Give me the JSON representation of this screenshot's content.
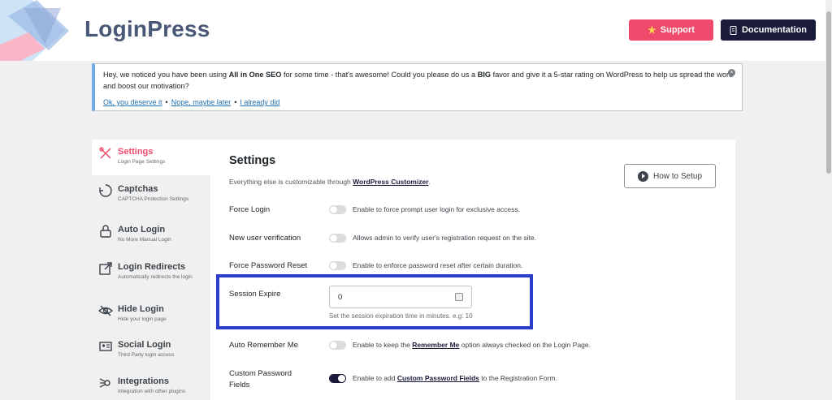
{
  "header": {
    "logo_text": "LoginPress",
    "support_label": "Support",
    "docs_label": "Documentation"
  },
  "notice": {
    "text_before": "Hey, we noticed you have been using ",
    "product": "All in One SEO",
    "text_mid": " for some time - that's awesome! Could you please do us a ",
    "emphasis": "BIG",
    "text_after": " favor and give it a 5-star rating on WordPress to help us spread the word and boost our motivation?",
    "links": [
      "Ok, you deserve it",
      "Nope, maybe later",
      "I already did"
    ],
    "dot": "•",
    "close_glyph": "×"
  },
  "sidebar": {
    "items": [
      {
        "title": "Settings",
        "sub": "Login Page Settings"
      },
      {
        "title": "Captchas",
        "sub": "CAPTCHA Protection Settings"
      },
      {
        "title": "Auto Login",
        "sub": "No More Manual Login"
      },
      {
        "title": "Login Redirects",
        "sub": "Automatically redirects the login"
      },
      {
        "title": "Hide Login",
        "sub": "Hide your login page"
      },
      {
        "title": "Social Login",
        "sub": "Third Party login access"
      },
      {
        "title": "Integrations",
        "sub": "Integration with other plugins"
      }
    ]
  },
  "main": {
    "title": "Settings",
    "desc_before": "Everything else is customizable through ",
    "desc_link": "WordPress Customizer",
    "desc_after": ".",
    "setup_label": "How to Setup",
    "rows": [
      {
        "label": "Force Login",
        "desc": "Enable to force prompt user login for exclusive access.",
        "on": false
      },
      {
        "label": "New user verification",
        "desc": "Allows admin to verify user's registration request on the site.",
        "on": false
      },
      {
        "label": "Force Password Reset",
        "desc": "Enable to enforce password reset after certain duration.",
        "on": false
      },
      {
        "label": "Auto Remember Me",
        "desc_before": "Enable to keep the ",
        "desc_link": "Remember Me",
        "desc_after": " option always checked on the Login Page.",
        "on": false
      },
      {
        "label": "Custom Password Fields",
        "desc_before": "Enable to add ",
        "desc_link": "Custom Password Fields",
        "desc_after": " to the Registration Form.",
        "on": true
      }
    ],
    "session": {
      "label": "Session Expire",
      "value": "0",
      "help": "Set the session expiration time in minutes. e.g: 10"
    }
  },
  "colors": {
    "brand_pink": "#ef4a6b",
    "brand_navy": "#1a1b3a",
    "highlight_blue": "#2b3ec9"
  }
}
